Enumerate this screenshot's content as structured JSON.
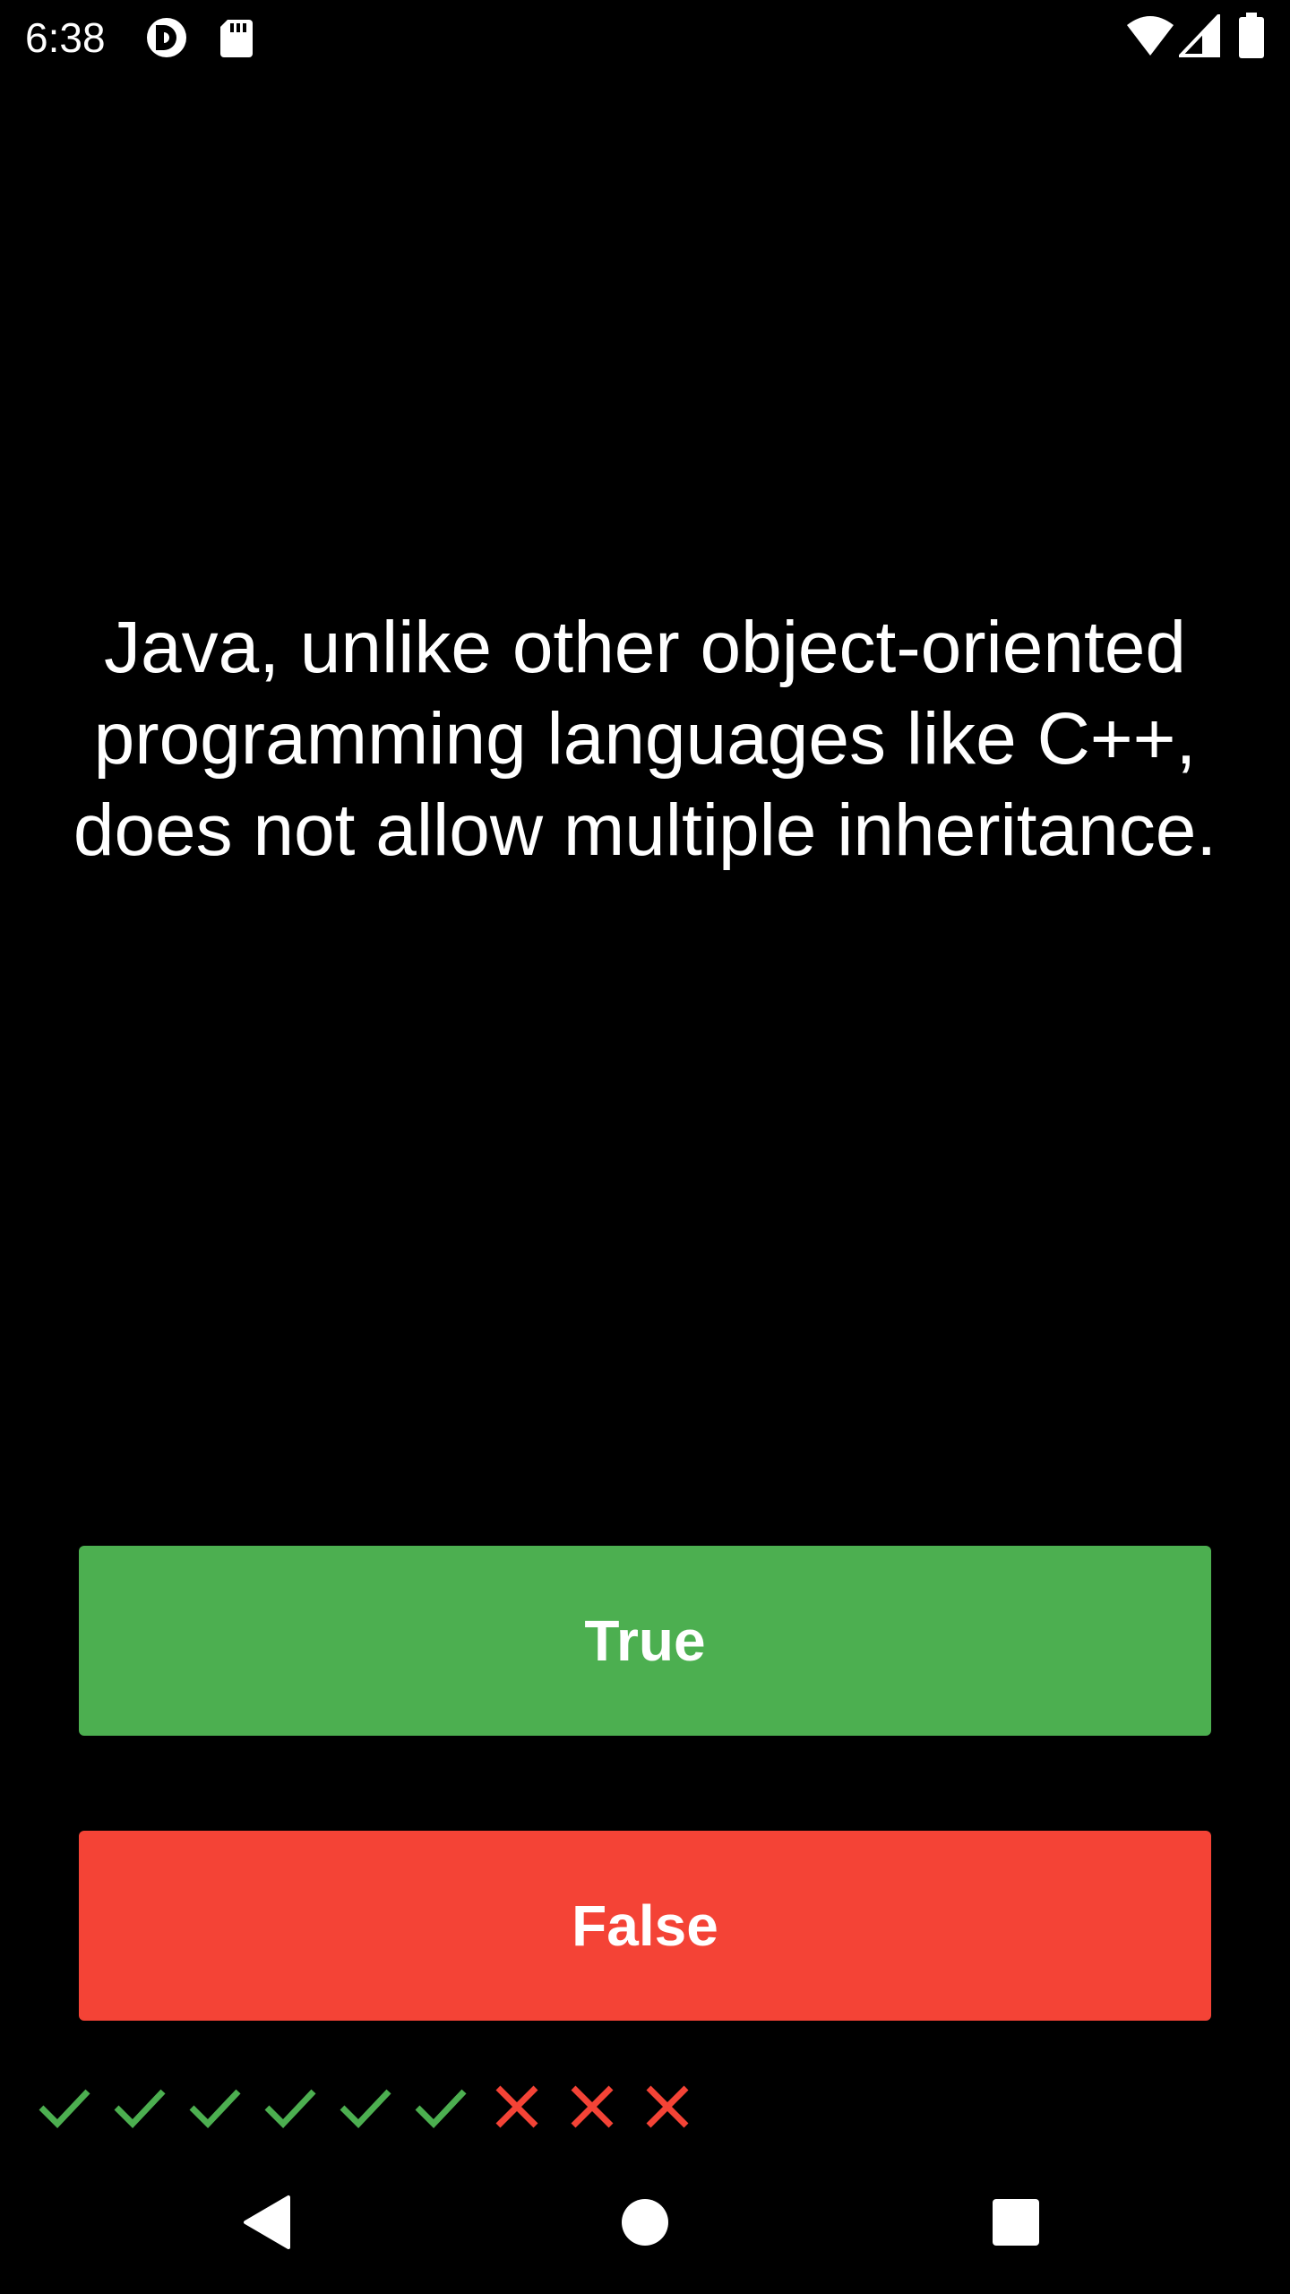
{
  "status_bar": {
    "time": "6:38",
    "left_icons": [
      "app-notification-icon",
      "sd-card-icon"
    ],
    "right_icons": [
      "wifi-icon",
      "cellular-signal-icon",
      "battery-icon"
    ]
  },
  "question": {
    "text": "Java, unlike other object-oriented programming languages like C++, does not allow multiple inheritance."
  },
  "buttons": {
    "true_label": "True",
    "false_label": "False"
  },
  "colors": {
    "true": "#4CAF50",
    "false": "#F44336",
    "background": "#000000"
  },
  "score": {
    "marks": [
      "correct",
      "correct",
      "correct",
      "correct",
      "correct",
      "correct",
      "incorrect",
      "incorrect",
      "incorrect"
    ]
  },
  "nav_bar": {
    "icons": [
      "back-icon",
      "home-icon",
      "recents-icon"
    ]
  }
}
